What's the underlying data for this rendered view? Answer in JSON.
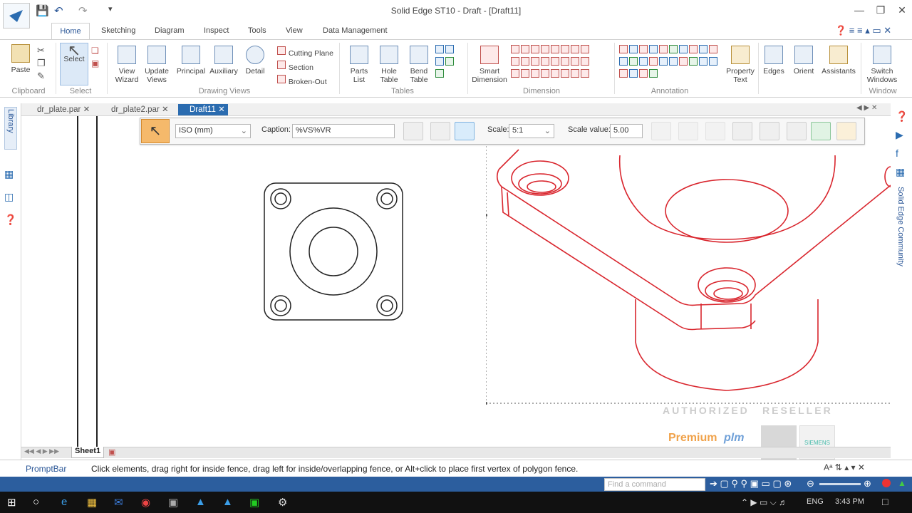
{
  "window": {
    "title": "Solid Edge ST10 - Draft - [Draft11]",
    "qa_dropdown": "▾",
    "min": "—",
    "restore": "❐",
    "close": "✕"
  },
  "ribbon_tabs": [
    "Home",
    "Sketching",
    "Diagram",
    "Inspect",
    "Tools",
    "View",
    "Data Management"
  ],
  "ribbon": {
    "clipboard": {
      "paste": "Paste",
      "group": "Clipboard"
    },
    "select": {
      "select": "Select",
      "group": "Select"
    },
    "drawing_views": {
      "view_wizard": "View Wizard",
      "update_views": "Update Views",
      "principal": "Principal",
      "auxiliary": "Auxiliary",
      "detail": "Detail",
      "cutting_plane": "Cutting Plane",
      "section": "Section",
      "broken_out": "Broken-Out",
      "group": "Drawing Views"
    },
    "tables": {
      "parts_list": "Parts List",
      "hole_table": "Hole Table",
      "bend_table": "Bend Table",
      "group": "Tables"
    },
    "dimension": {
      "smart_dimension": "Smart Dimension",
      "group": "Dimension"
    },
    "annotation": {
      "property_text": "Property Text",
      "group": "Annotation"
    },
    "misc": {
      "edges": "Edges",
      "orient": "Orient",
      "assistants": "Assistants",
      "switch_windows": "Switch Windows",
      "window_group": "Window"
    }
  },
  "doc_tabs": [
    "dr_plate.par",
    "dr_plate2.par",
    "Draft11"
  ],
  "left_panel": {
    "library": "Library"
  },
  "right_panel": {
    "community": "Solid Edge Community"
  },
  "command_bar": {
    "standard": "ISO (mm)",
    "caption_label": "Caption:",
    "caption_value": "%VS%VR",
    "scale_label": "Scale:",
    "scale_value": "5:1",
    "scale_value_label": "Scale value:",
    "scale_value_input": "5.00"
  },
  "watermark": {
    "authorized": "AUTHORIZED",
    "reseller": "RESELLER",
    "brand": "Premium",
    "brand2": "plm",
    "siemens": "SIEMENS"
  },
  "sheet": {
    "tab": "Sheet1"
  },
  "status": {
    "promptbar": "PromptBar",
    "message": "Click elements, drag right for inside fence, drag left for inside/overlapping fence, or Alt+click to place first vertex of polygon fence.",
    "find_placeholder": "Find a command"
  },
  "taskbar": {
    "lang": "ENG",
    "time": "3:43 PM"
  },
  "colors": {
    "accent": "#2b6cb0",
    "isometric": "#d9262e",
    "ribbon_blue": "#2b5797"
  }
}
